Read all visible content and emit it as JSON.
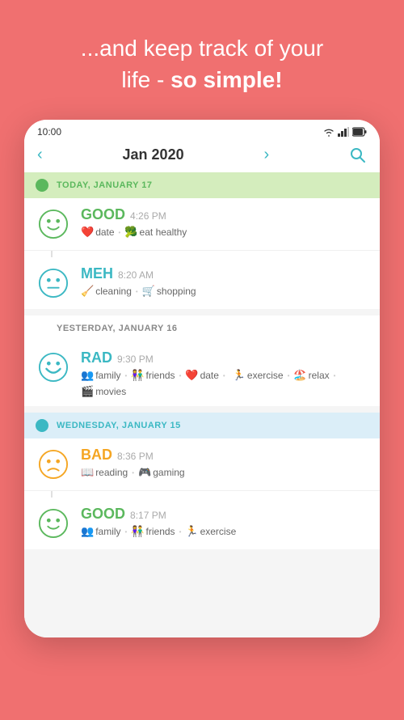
{
  "header": {
    "line1": "...and keep track of your",
    "line2_normal": "life - ",
    "line2_bold": "so simple!"
  },
  "phone": {
    "status": {
      "time": "10:00",
      "icons": [
        "wifi",
        "signal",
        "battery"
      ]
    },
    "nav": {
      "prev_arrow": "‹",
      "title": "Jan 2020",
      "next_arrow": "›",
      "search_icon": "🔍"
    },
    "days": [
      {
        "id": "today",
        "type": "today",
        "label": "TODAY, JANUARY 17",
        "dot_color": "green",
        "entries": [
          {
            "mood": "GOOD",
            "mood_type": "good",
            "time": "4:26 PM",
            "tags": [
              {
                "icon": "❤️",
                "label": "date"
              },
              {
                "icon": "🥦",
                "label": "eat healthy"
              }
            ]
          },
          {
            "mood": "MEH",
            "mood_type": "meh",
            "time": "8:20 AM",
            "tags": [
              {
                "icon": "🧹",
                "label": "cleaning"
              },
              {
                "icon": "🛒",
                "label": "shopping"
              }
            ]
          }
        ]
      },
      {
        "id": "yesterday",
        "type": "yesterday",
        "label": "YESTERDAY, JANUARY 16",
        "dot_color": "none",
        "entries": [
          {
            "mood": "RAD",
            "mood_type": "rad",
            "time": "9:30 PM",
            "tags": [
              {
                "icon": "👥",
                "label": "family"
              },
              {
                "icon": "👫",
                "label": "friends"
              },
              {
                "icon": "❤️",
                "label": "date"
              },
              {
                "icon": "🏃",
                "label": "exercise"
              },
              {
                "icon": "🏖️",
                "label": "relax"
              },
              {
                "icon": "🎬",
                "label": "movies"
              }
            ]
          }
        ]
      },
      {
        "id": "wednesday",
        "type": "wednesday",
        "label": "WEDNESDAY, JANUARY 15",
        "dot_color": "teal",
        "entries": [
          {
            "mood": "BAD",
            "mood_type": "bad",
            "time": "8:36 PM",
            "tags": [
              {
                "icon": "📖",
                "label": "reading"
              },
              {
                "icon": "🎮",
                "label": "gaming"
              }
            ]
          },
          {
            "mood": "GOOD",
            "mood_type": "good",
            "time": "8:17 PM",
            "tags": [
              {
                "icon": "👥",
                "label": "family"
              },
              {
                "icon": "👫",
                "label": "friends"
              },
              {
                "icon": "🏃",
                "label": "exercise"
              }
            ]
          }
        ]
      }
    ]
  },
  "colors": {
    "background": "#F07070",
    "good": "#5BB85D",
    "meh": "#3BB8C3",
    "rad": "#3BB8C3",
    "bad": "#F5A623",
    "today_bg": "#d4edbd",
    "wednesday_bg": "#dbeef8"
  }
}
